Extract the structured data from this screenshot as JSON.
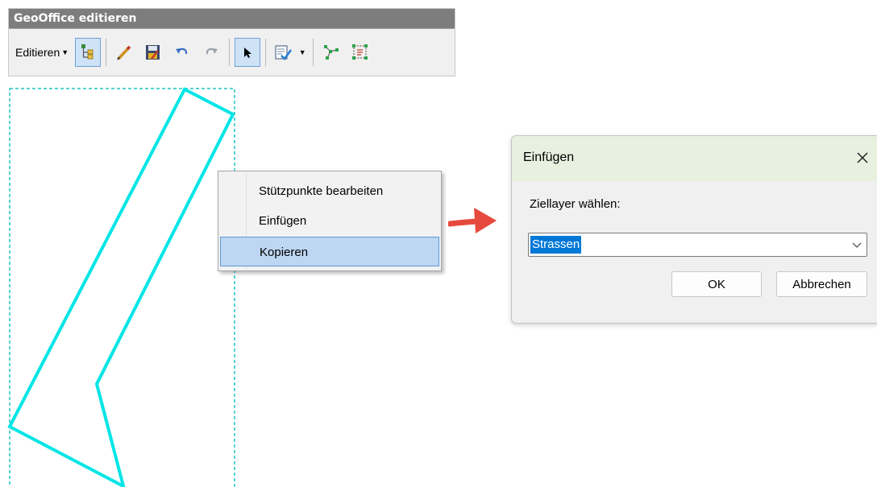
{
  "toolbar": {
    "title": "GeoOffice editieren",
    "menu_label": "Editieren",
    "icons": [
      "editor-tree-icon",
      "pencil-icon",
      "save-edits-icon",
      "undo-icon",
      "redo-icon",
      "select-pointer-icon",
      "attribute-edit-icon",
      "vertex-tool-icon",
      "topology-tool-icon"
    ]
  },
  "context_menu": {
    "items": [
      "Stützpunkte bearbeiten",
      "Einfügen",
      "Kopieren"
    ],
    "selected": "Kopieren"
  },
  "dialog": {
    "title": "Einfügen",
    "label": "Ziellayer wählen:",
    "selected_layer": "Strassen",
    "ok_label": "OK",
    "cancel_label": "Abbrechen"
  },
  "colors": {
    "feature_outline": "#00e5e5",
    "arrow": "#e64a3e",
    "selection_blue": "#0078d7",
    "menu_highlight": "#bdd6f1"
  }
}
